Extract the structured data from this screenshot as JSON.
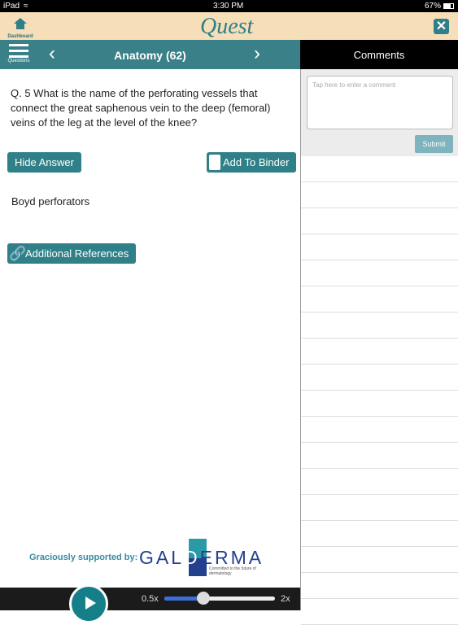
{
  "status": {
    "device": "iPad",
    "time": "3:30 PM",
    "battery": "67%"
  },
  "header": {
    "dashboard_label": "Dashboard",
    "logo": "Quest",
    "close_icon": "close-icon"
  },
  "nav": {
    "menu_label": "Questions",
    "title": "Anatomy (62)"
  },
  "question": {
    "text": "Q. 5 What is the name of the perforating vessels that connect the great saphenous vein to the deep (femoral) veins of the leg at the level of the knee?",
    "hide_answer": "Hide Answer",
    "add_to_binder": "Add To Binder",
    "answer": "Boyd perforators",
    "additional_references": "Additional References"
  },
  "sponsor": {
    "label": "Graciously supported by:",
    "logo": "GALDERMA",
    "tagline": "Committed to the future of dermatology"
  },
  "player": {
    "min_label": "0.5x",
    "max_label": "2x",
    "slider_fraction": 0.35
  },
  "comments": {
    "title": "Comments",
    "placeholder": "Tap here to enter a comment",
    "submit": "Submit"
  },
  "colors": {
    "teal": "#3a8088",
    "header_bg": "#f6dfb8"
  }
}
